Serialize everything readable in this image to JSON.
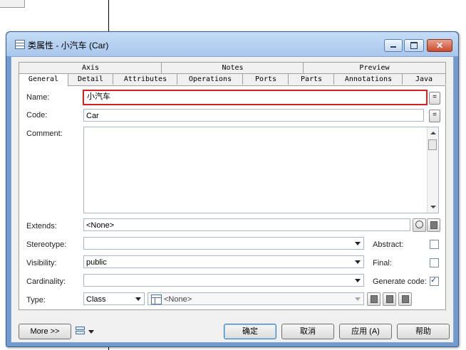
{
  "window": {
    "title": "类属性 - 小汽车 (Car)",
    "close_glyph": "✕"
  },
  "tabs": {
    "top_row": [
      "Axis",
      "Notes",
      "Preview"
    ],
    "bottom_row": [
      "General",
      "Detail",
      "Attributes",
      "Operations",
      "Ports",
      "Parts",
      "Annotations",
      "Java"
    ],
    "active": "General"
  },
  "form": {
    "name_label": "Name:",
    "name_value": "小汽车",
    "name_button": "=",
    "code_label": "Code:",
    "code_value": "Car",
    "code_button": "=",
    "comment_label": "Comment:",
    "comment_value": "",
    "extends_label": "Extends:",
    "extends_value": "<None>",
    "stereotype_label": "Stereotype:",
    "stereotype_value": "",
    "visibility_label": "Visibility:",
    "visibility_value": "public",
    "cardinality_label": "Cardinality:",
    "cardinality_value": "",
    "type_label": "Type:",
    "type_value": "Class",
    "type_target_value": "<None>",
    "abstract_label": "Abstract:",
    "abstract_checked": false,
    "final_label": "Final:",
    "final_checked": false,
    "generate_code_label": "Generate code:",
    "generate_code_checked": true
  },
  "footer": {
    "more_label": "More >>",
    "ok_label": "确定",
    "cancel_label": "取消",
    "apply_label": "应用 (A)",
    "help_label": "帮助"
  },
  "colors": {
    "focus_border": "#d42020",
    "title_bar": "#a9c7ec",
    "close_button": "#c84b2e"
  }
}
